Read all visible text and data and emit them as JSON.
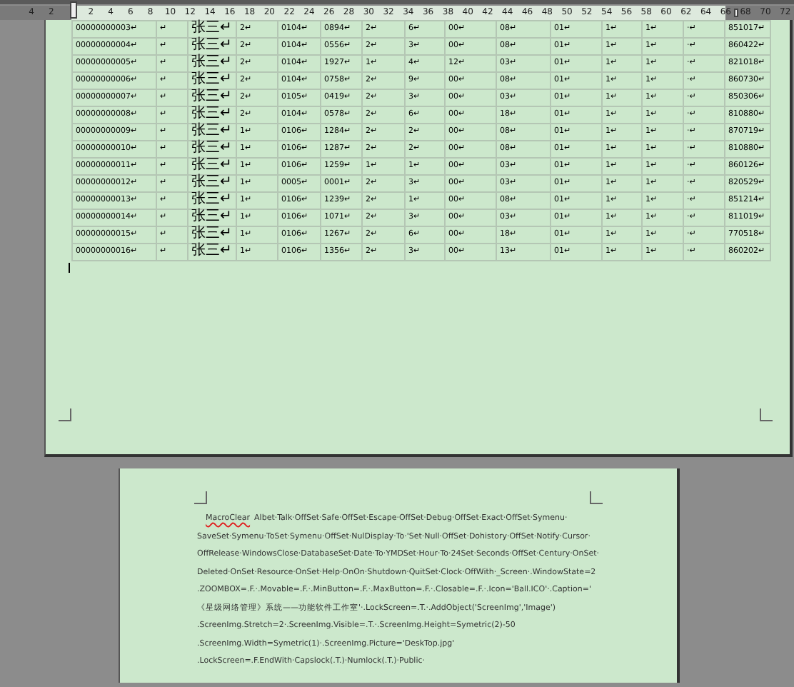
{
  "ruler": {
    "left_labels": [
      "4",
      "2"
    ],
    "labels": [
      "2",
      "4",
      "6",
      "8",
      "10",
      "12",
      "14",
      "16",
      "18",
      "20",
      "22",
      "24",
      "26",
      "28",
      "30",
      "32",
      "34",
      "36",
      "38",
      "40",
      "42",
      "44",
      "46",
      "48",
      "50",
      "52",
      "54",
      "56",
      "58",
      "60",
      "62",
      "64",
      "66",
      "68",
      "70",
      "72"
    ]
  },
  "table": {
    "rows": [
      [
        "00000000003↵",
        "↵",
        "张三↵",
        "2↵",
        "0104↵",
        "0894↵",
        "2↵",
        "6↵",
        "00↵",
        "08↵",
        "01↵",
        "1↵",
        "1↵",
        "·↵",
        "851017↵"
      ],
      [
        "00000000004↵",
        "↵",
        "张三↵",
        "2↵",
        "0104↵",
        "0556↵",
        "2↵",
        "3↵",
        "00↵",
        "08↵",
        "01↵",
        "1↵",
        "1↵",
        "·↵",
        "860422↵"
      ],
      [
        "00000000005↵",
        "↵",
        "张三↵",
        "2↵",
        "0104↵",
        "1927↵",
        "1↵",
        "4↵",
        "12↵",
        "03↵",
        "01↵",
        "1↵",
        "1↵",
        "·↵",
        "821018↵"
      ],
      [
        "00000000006↵",
        "↵",
        "张三↵",
        "2↵",
        "0104↵",
        "0758↵",
        "2↵",
        "9↵",
        "00↵",
        "08↵",
        "01↵",
        "1↵",
        "1↵",
        "·↵",
        "860730↵"
      ],
      [
        "00000000007↵",
        "↵",
        "张三↵",
        "2↵",
        "0105↵",
        "0419↵",
        "2↵",
        "3↵",
        "00↵",
        "03↵",
        "01↵",
        "1↵",
        "1↵",
        "·↵",
        "850306↵"
      ],
      [
        "00000000008↵",
        "↵",
        "张三↵",
        "2↵",
        "0104↵",
        "0578↵",
        "2↵",
        "6↵",
        "00↵",
        "18↵",
        "01↵",
        "1↵",
        "1↵",
        "·↵",
        "810880↵"
      ],
      [
        "00000000009↵",
        "↵",
        "张三↵",
        "1↵",
        "0106↵",
        "1284↵",
        "2↵",
        "2↵",
        "00↵",
        "08↵",
        "01↵",
        "1↵",
        "1↵",
        "·↵",
        "870719↵"
      ],
      [
        "00000000010↵",
        "↵",
        "张三↵",
        "1↵",
        "0106↵",
        "1287↵",
        "2↵",
        "2↵",
        "00↵",
        "08↵",
        "01↵",
        "1↵",
        "1↵",
        "·↵",
        "810880↵"
      ],
      [
        "00000000011↵",
        "↵",
        "张三↵",
        "1↵",
        "0106↵",
        "1259↵",
        "1↵",
        "1↵",
        "00↵",
        "03↵",
        "01↵",
        "1↵",
        "1↵",
        "·↵",
        "860126↵"
      ],
      [
        "00000000012↵",
        "↵",
        "张三↵",
        "1↵",
        "0005↵",
        "0001↵",
        "2↵",
        "3↵",
        "00↵",
        "03↵",
        "01↵",
        "1↵",
        "1↵",
        "·↵",
        "820529↵"
      ],
      [
        "00000000013↵",
        "↵",
        "张三↵",
        "1↵",
        "0106↵",
        "1239↵",
        "2↵",
        "1↵",
        "00↵",
        "08↵",
        "01↵",
        "1↵",
        "1↵",
        "·↵",
        "851214↵"
      ],
      [
        "00000000014↵",
        "↵",
        "张三↵",
        "1↵",
        "0106↵",
        "1071↵",
        "2↵",
        "3↵",
        "00↵",
        "03↵",
        "01↵",
        "1↵",
        "1↵",
        "·↵",
        "811019↵"
      ],
      [
        "00000000015↵",
        "↵",
        "张三↵",
        "1↵",
        "0106↵",
        "1267↵",
        "2↵",
        "6↵",
        "00↵",
        "18↵",
        "01↵",
        "1↵",
        "1↵",
        "·↵",
        "770518↵"
      ],
      [
        "00000000016↵",
        "↵",
        "张三↵",
        "1↵",
        "0106↵",
        "1356↵",
        "2↵",
        "3↵",
        "00↵",
        "13↵",
        "01↵",
        "1↵",
        "1↵",
        "·↵",
        "860202↵"
      ]
    ]
  },
  "page2": {
    "spelling_error": "MacroClear",
    "lines": [
      "Albet·Talk·OffSet·Safe·OffSet·Escape·OffSet·Debug·OffSet·Exact·OffSet·Symenu·",
      "SaveSet·Symenu·ToSet·Symenu·OffSet·NulDisplay·To·'Set·Null·OffSet·Dohistory·OffSet·Notify·Cursor·",
      "OffRelease·WindowsClose·DatabaseSet·Date·To·YMDSet·Hour·To·24Set·Seconds·OffSet·Century·OnSet·",
      "Deleted·OnSet·Resource·OnSet·Help·OnOn·Shutdown·QuitSet·Clock·OffWith·_Screen·.WindowState=2",
      ".ZOOMBOX=.F.·.Movable=.F.·.MinButton=.F.·.MaxButton=.F.·.Closable=.F.·.Icon='Ball.ICO'·.Caption='",
      "《星级网络管理》系统——功能软件工作室'·.LockScreen=.T.·.AddObject('ScreenImg','Image')",
      ".ScreenImg.Stretch=2·.ScreenImg.Visible=.T.·.ScreenImg.Height=Symetric(2)-50",
      ".ScreenImg.Width=Symetric(1)·.ScreenImg.Picture='DeskTop.jpg'",
      ".LockScreen=.F.EndWith·Capslock(.T.)·Numlock(.T.)·Public·"
    ]
  }
}
